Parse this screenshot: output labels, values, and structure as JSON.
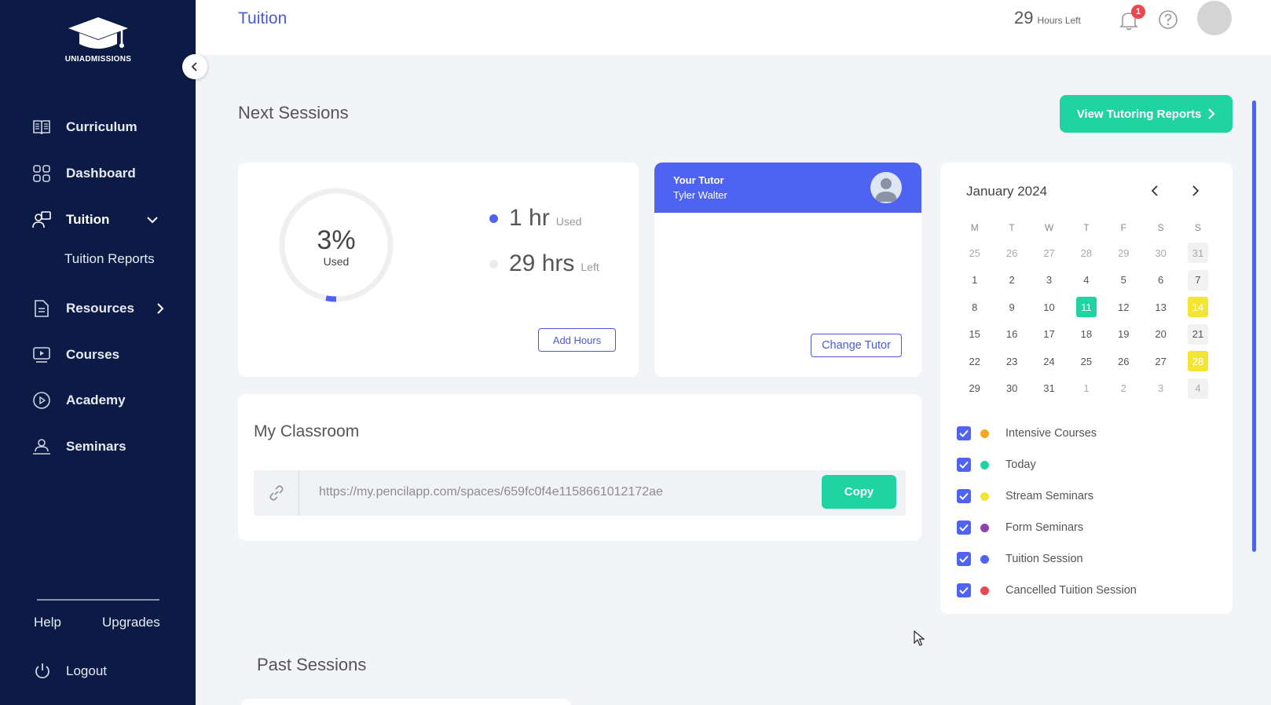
{
  "brand": {
    "logo_text": "UNIADMISSIONS"
  },
  "sidebar": {
    "items": [
      {
        "label": "Curriculum",
        "icon": "book-icon"
      },
      {
        "label": "Dashboard",
        "icon": "grid-icon"
      },
      {
        "label": "Tuition",
        "icon": "tutor-icon"
      },
      {
        "label": "Resources",
        "icon": "document-icon"
      },
      {
        "label": "Courses",
        "icon": "video-icon"
      },
      {
        "label": "Academy",
        "icon": "play-circle-icon"
      },
      {
        "label": "Seminars",
        "icon": "presenter-icon"
      }
    ],
    "sub_item": "Tuition Reports",
    "help": "Help",
    "upgrades": "Upgrades",
    "logout": "Logout"
  },
  "header": {
    "title": "Tuition",
    "hours_value": "29",
    "hours_label": "Hours Left",
    "notification_count": "1"
  },
  "next_sessions": {
    "title": "Next Sessions",
    "reports_button": "View Tutoring Reports",
    "usage": {
      "percent_label": "3%",
      "percent_value": 3,
      "center_label": "Used",
      "used_value": "1 hr",
      "used_label": "Used",
      "left_value": "29 hrs",
      "left_label": "Left",
      "add_button": "Add Hours"
    },
    "tutor": {
      "heading": "Your Tutor",
      "name": "Tyler Walter",
      "change_button": "Change Tutor"
    }
  },
  "classroom": {
    "title": "My Classroom",
    "link": "https://my.pencilapp.com/spaces/659fc0f4e1158661012172ae",
    "copy_button": "Copy"
  },
  "calendar": {
    "month": "January 2024",
    "weekdays": [
      "M",
      "T",
      "W",
      "T",
      "F",
      "S",
      "S"
    ],
    "weeks": [
      [
        "25",
        "26",
        "27",
        "28",
        "29",
        "30",
        "31"
      ],
      [
        "1",
        "2",
        "3",
        "4",
        "5",
        "6",
        "7"
      ],
      [
        "8",
        "9",
        "10",
        "11",
        "12",
        "13",
        "14"
      ],
      [
        "15",
        "16",
        "17",
        "18",
        "19",
        "20",
        "21"
      ],
      [
        "22",
        "23",
        "24",
        "25",
        "26",
        "27",
        "28"
      ],
      [
        "29",
        "30",
        "31",
        "1",
        "2",
        "3",
        "4"
      ]
    ],
    "legend": [
      {
        "label": "Intensive Courses",
        "color": "#f5a623"
      },
      {
        "label": "Today",
        "color": "#1fd3a3"
      },
      {
        "label": "Stream Seminars",
        "color": "#f2e533"
      },
      {
        "label": "Form Seminars",
        "color": "#8e44ad"
      },
      {
        "label": "Tuition Session",
        "color": "#4e63f2"
      },
      {
        "label": "Cancelled Tuition Session",
        "color": "#e8484f"
      }
    ]
  },
  "past_sessions": {
    "title": "Past Sessions"
  },
  "colors": {
    "sidebar": "#0c1b45",
    "accent": "#4e63f2",
    "success": "#1fd3a3",
    "highlight": "#f2e533"
  }
}
